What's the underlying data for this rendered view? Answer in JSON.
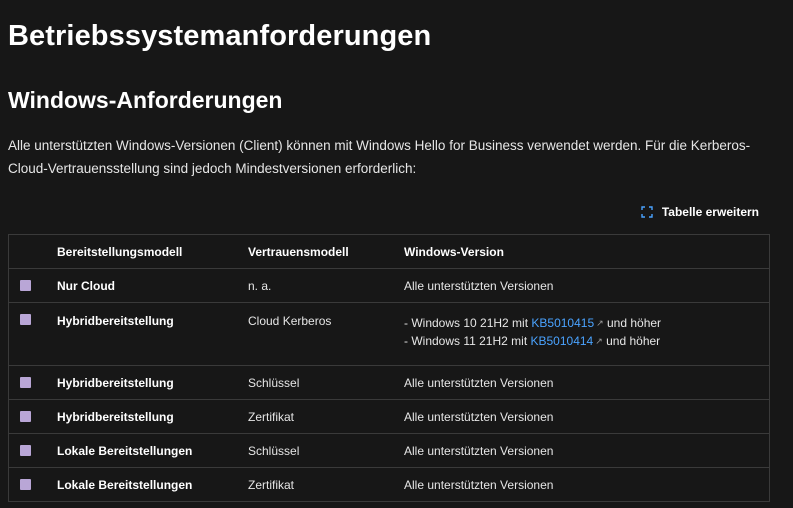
{
  "page": {
    "title": "Betriebssystemanforderungen",
    "subtitle": "Windows-Anforderungen",
    "paragraph": "Alle unterstützten Windows-Versionen (Client) können mit Windows Hello for Business verwendet werden. Für die Kerberos-Cloud-Vertrauensstellung sind jedoch Mindestversionen erforderlich:"
  },
  "expand_button": {
    "label": "Tabelle erweitern",
    "icon": "expand-icon"
  },
  "table": {
    "headers": [
      "Bereitstellungsmodell",
      "Vertrauensmodell",
      "Windows-Version"
    ],
    "rows": [
      {
        "model": "Nur Cloud",
        "trust": "n. a.",
        "version": "Alle unterstützten Versionen"
      },
      {
        "model": "Hybridbereitstellung",
        "trust": "Cloud Kerberos",
        "version_lines": [
          {
            "prefix": "- Windows 10 21H2 mit ",
            "link": "KB5010415",
            "suffix": " und höher"
          },
          {
            "prefix": "- Windows 11 21H2 mit ",
            "link": "KB5010414",
            "suffix": " und höher"
          }
        ]
      },
      {
        "model": "Hybridbereitstellung",
        "trust": "Schlüssel",
        "version": "Alle unterstützten Versionen"
      },
      {
        "model": "Hybridbereitstellung",
        "trust": "Zertifikat",
        "version": "Alle unterstützten Versionen"
      },
      {
        "model": "Lokale Bereitstellungen",
        "trust": "Schlüssel",
        "version": "Alle unterstützten Versionen"
      },
      {
        "model": "Lokale Bereitstellungen",
        "trust": "Zertifikat",
        "version": "Alle unterstützten Versionen"
      }
    ]
  },
  "colors": {
    "background": "#171717",
    "link": "#4aa3ff",
    "row_marker": "#b9a6d6",
    "border": "#3a3a3a"
  }
}
